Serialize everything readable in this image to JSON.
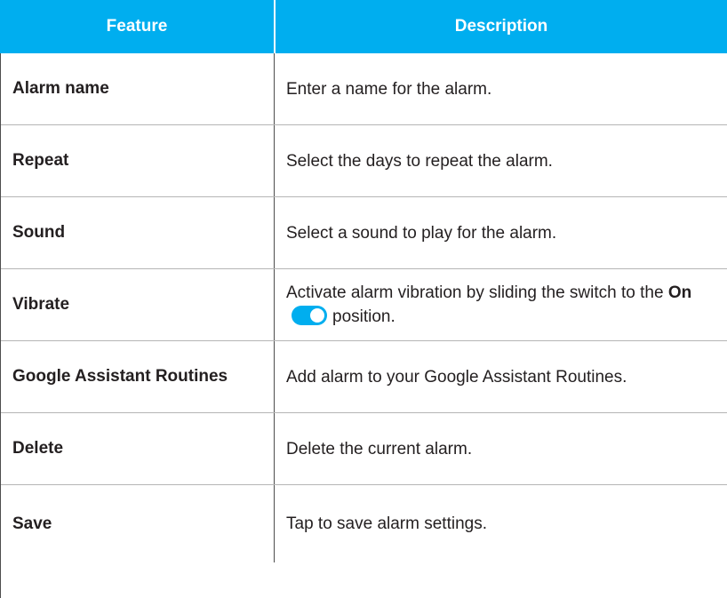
{
  "header": {
    "col1": "Feature",
    "col2": "Description"
  },
  "rows": [
    {
      "feature": "Alarm name",
      "description": "Enter a name for the alarm."
    },
    {
      "feature": "Repeat",
      "description": "Select the days to repeat the alarm."
    },
    {
      "feature": "Sound",
      "description": "Select a sound to play for the alarm."
    },
    {
      "feature": "Vibrate",
      "description_prefix": "Activate alarm vibration by sliding the switch to the",
      "description_bold": "On",
      "description_suffix": "position."
    },
    {
      "feature": "Google Assistant Routines",
      "description": "Add alarm to your Google Assistant Routines."
    },
    {
      "feature": "Delete",
      "description": "Delete the current alarm."
    },
    {
      "feature": "Save",
      "description": "Tap to save alarm settings."
    }
  ],
  "colors": {
    "header_bg": "#00aeef",
    "toggle": "#00aeef",
    "text": "#231f20"
  },
  "icons": {
    "toggle": "toggle-switch-on-icon"
  }
}
